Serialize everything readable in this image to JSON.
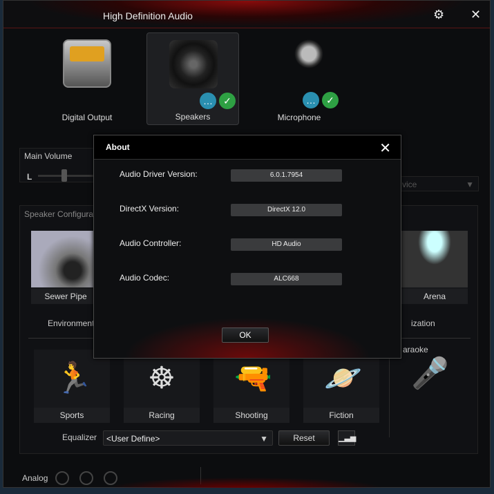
{
  "window": {
    "title": "High Definition Audio",
    "settings_icon": "gear-icon",
    "close_icon": "close-icon"
  },
  "devices": [
    {
      "label": "Digital Output"
    },
    {
      "label": "Speakers",
      "selected": true
    },
    {
      "label": "Microphone"
    }
  ],
  "main_volume": {
    "label": "Main Volume",
    "left_label": "L"
  },
  "device_dropdown": {
    "visible_text": "vice"
  },
  "speaker_config": {
    "label": "Speaker Configurat"
  },
  "environments": {
    "items": [
      "Sewer Pipe",
      "Arena"
    ],
    "label": "Environment",
    "right_label": "ization"
  },
  "effects": {
    "items": [
      "Sports",
      "Racing",
      "Shooting",
      "Fiction"
    ],
    "karaoke_label": "araoke"
  },
  "equalizer": {
    "label": "Equalizer",
    "value": "<User Define>",
    "reset_label": "Reset"
  },
  "bottom": {
    "analog_label": "Analog"
  },
  "about": {
    "title": "About",
    "rows": [
      {
        "label": "Audio Driver Version:",
        "value": "6.0.1.7954"
      },
      {
        "label": "DirectX Version:",
        "value": "DirectX 12.0"
      },
      {
        "label": "Audio Controller:",
        "value": "HD Audio"
      },
      {
        "label": "Audio Codec:",
        "value": "ALC668"
      }
    ],
    "ok_label": "OK"
  },
  "colors": {
    "accent": "#b01010",
    "check": "#2ea043",
    "chat": "#2a8fb0"
  }
}
